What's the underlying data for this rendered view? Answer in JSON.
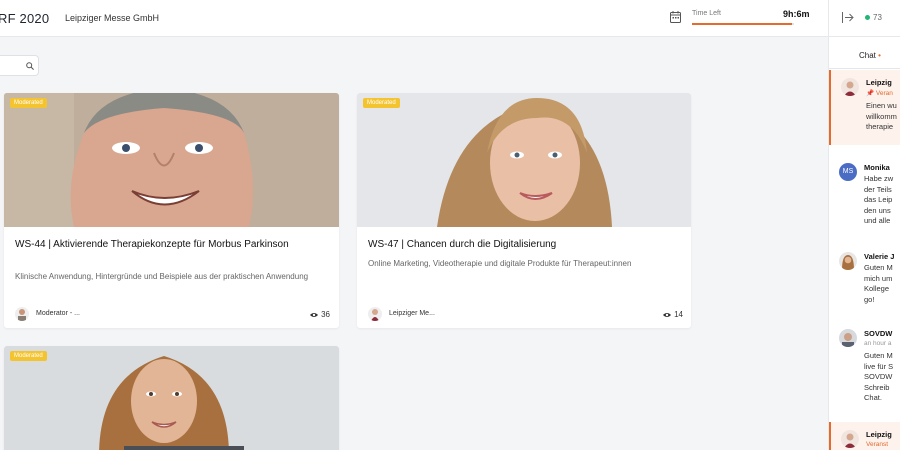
{
  "header": {
    "app_title": "RF 2020",
    "org_name": "Leipziger Messe GmbH",
    "time_left_label": "Time Left",
    "time_left_value": "9h:6m",
    "time_progress": 0.98,
    "accent": "#e46a2e"
  },
  "presence": {
    "online_count": "73",
    "exit_icon": "exit-icon"
  },
  "search": {
    "icon": "search-icon",
    "placeholder": ""
  },
  "cards": [
    {
      "badge": "Moderated",
      "title": "WS-44 | Aktivierende Therapiekonzepte für Morbus Parkinson",
      "description": "Klinische Anwendung, Hintergründe und Beispiele aus der praktischen Anwendung",
      "host": "Moderator - ...",
      "views": "36"
    },
    {
      "badge": "Moderated",
      "title": "WS-47 | Chancen durch die Digitalisierung",
      "description": "Online Marketing, Videotherapie und digitale Produkte für Therapeut:innen",
      "host": "Leipziger Me...",
      "views": "14"
    },
    {
      "badge": "Moderated"
    }
  ],
  "chat": {
    "tab_label": "Chat",
    "messages": [
      {
        "name": "Leipzig",
        "sub": "Veran",
        "body": "Einen wu\nwillkomm\ntherapie"
      },
      {
        "name": "Monika",
        "initials": "MS",
        "body": "Habe zw\nder Teils\ndas Leip\nden uns\nund alle"
      },
      {
        "name": "Valerie J",
        "body": "Guten M\nmich um\nKollege\ngo!"
      },
      {
        "name": "SOVDW",
        "sub": "an hour a",
        "body": "Guten M\nlive für S\nSOVDW\nSchreib\nChat."
      },
      {
        "name": "Leipzig",
        "sub": "Veranst"
      }
    ]
  }
}
